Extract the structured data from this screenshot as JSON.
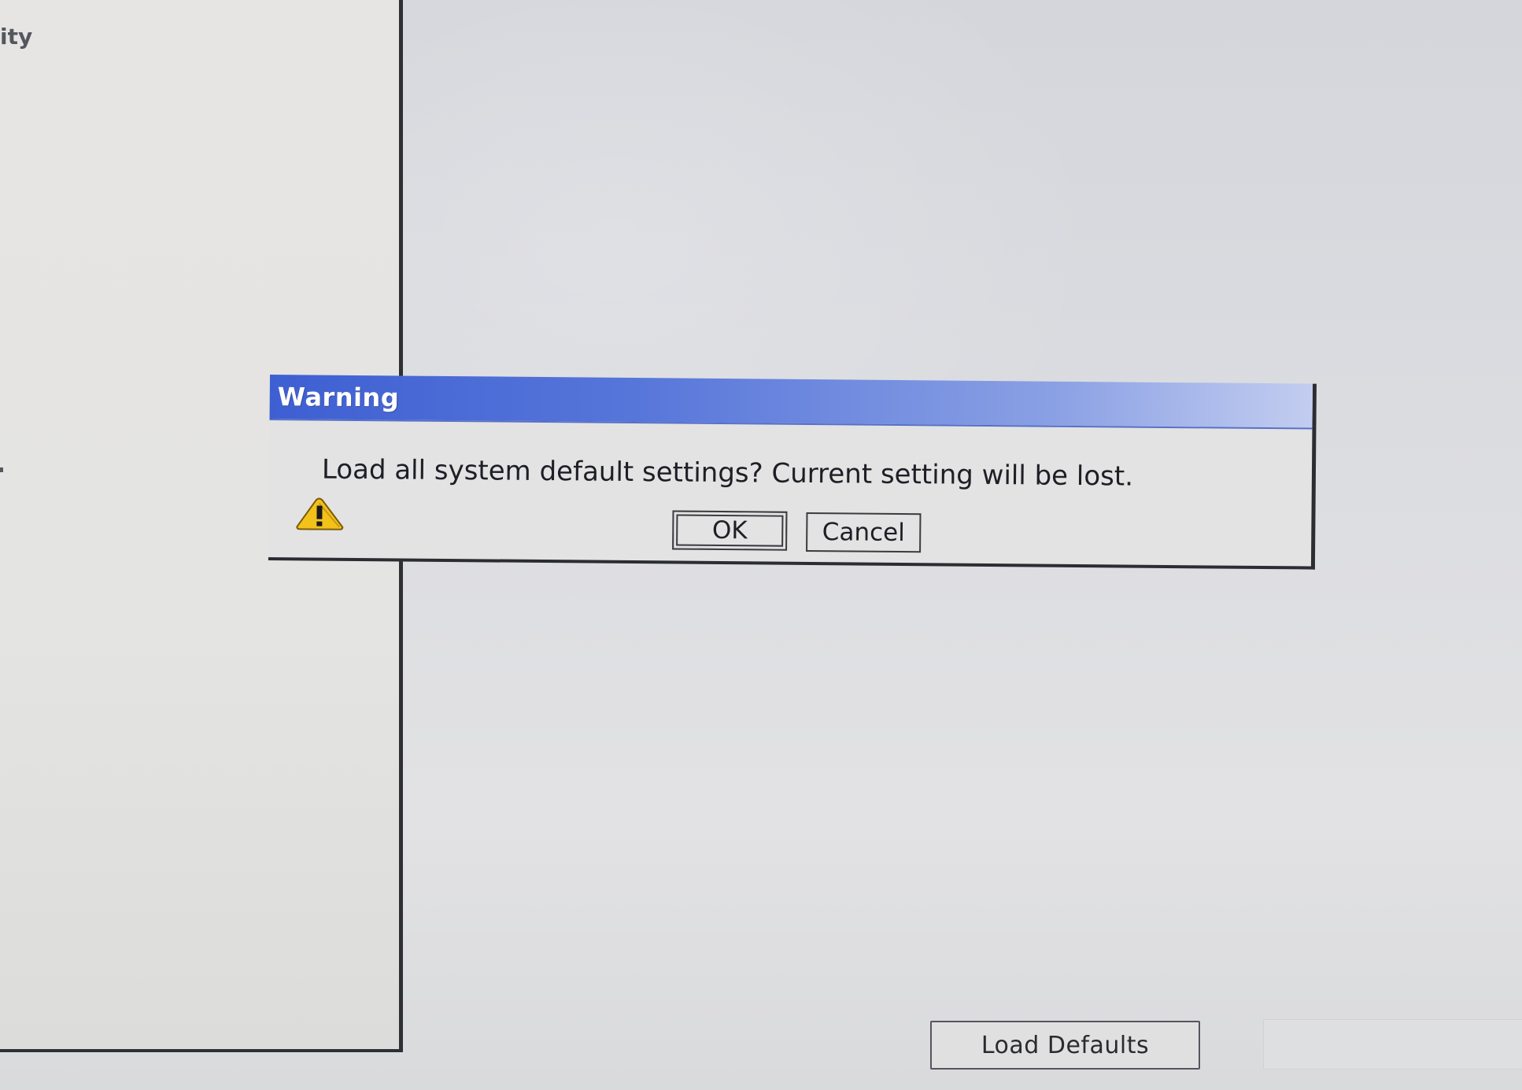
{
  "sidebar": {
    "partial_item_label": "ity"
  },
  "dialog": {
    "title": "Warning",
    "message": "Load all system default settings?  Current setting will be lost.",
    "icon": "warning-triangle-icon",
    "ok_label": "OK",
    "cancel_label": "Cancel"
  },
  "footer": {
    "load_defaults_label": "Load Defaults"
  },
  "colors": {
    "titlebar_start": "#3e5fd2",
    "titlebar_end": "#c3cdf0",
    "warning_yellow": "#f2c21b",
    "background": "#dcdde1"
  }
}
